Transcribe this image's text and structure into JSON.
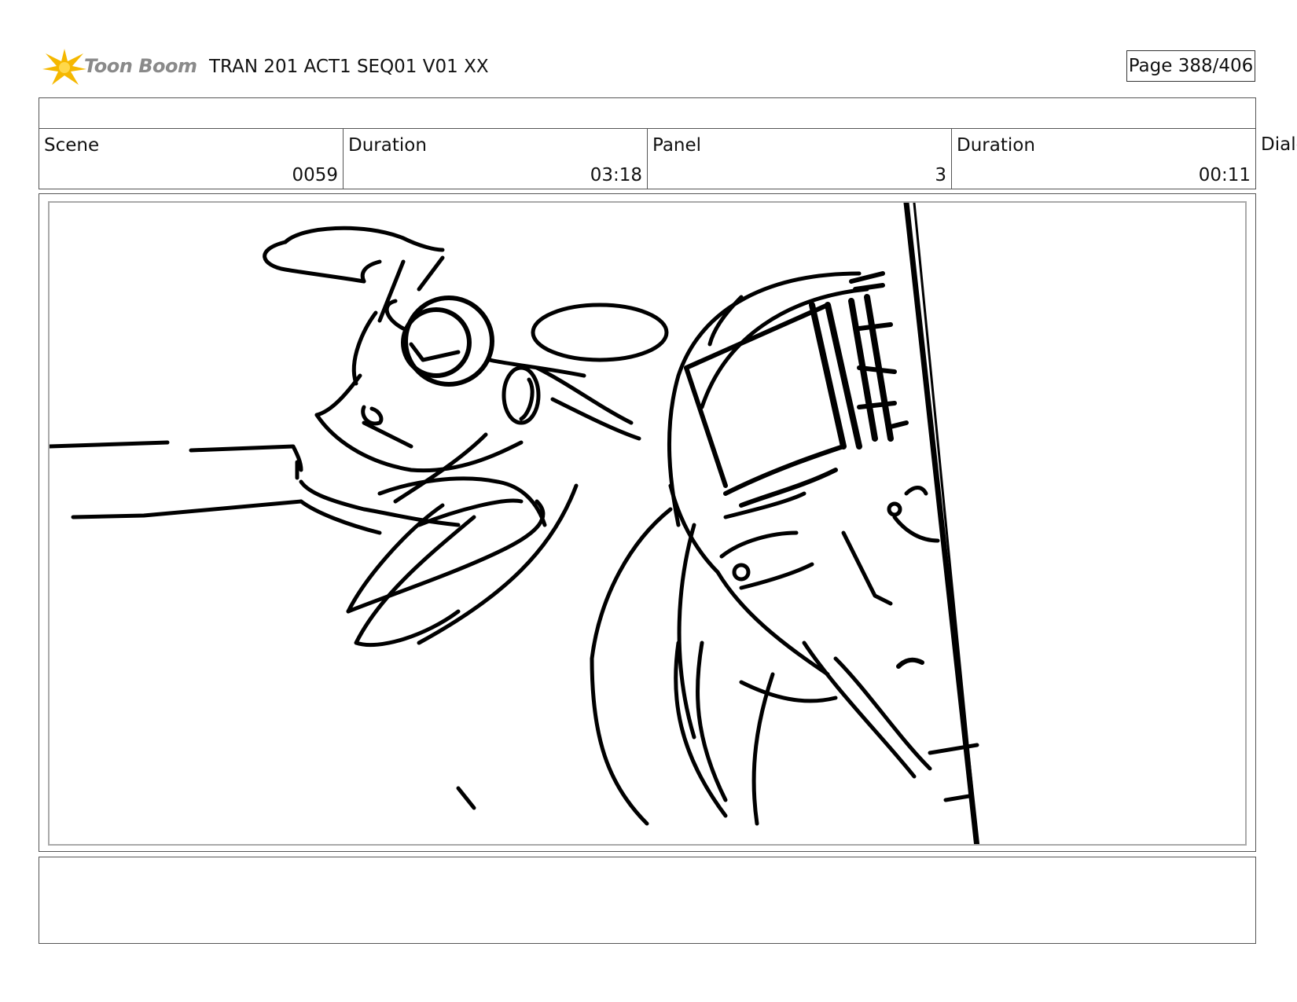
{
  "header": {
    "logo_text": "Toon Boom",
    "title": "TRAN 201 ACT1 SEQ01 V01 XX",
    "page_label": "Page 388/406"
  },
  "info": {
    "scene_label": "Scene",
    "scene_value": "0059",
    "duration_label": "Duration",
    "duration_value": "03:18",
    "panel_label": "Panel",
    "panel_value": "3",
    "panel_duration_label": "Duration",
    "panel_duration_value": "00:11",
    "dialog_label": "Dialo"
  },
  "colors": {
    "logo_star": "#f5b800",
    "logo_text": "#8a8a8a"
  }
}
